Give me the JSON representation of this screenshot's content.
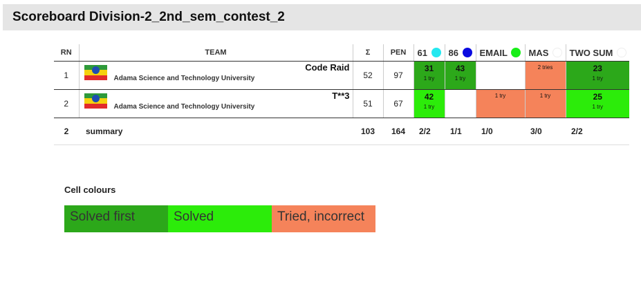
{
  "title": "Scoreboard Division-2_2nd_sem_contest_2",
  "columns": {
    "rn": "RN",
    "team": "TEAM",
    "sum": "Σ",
    "pen": "PEN"
  },
  "problems": [
    {
      "label": "61",
      "balloon": "#24e8f0"
    },
    {
      "label": "86",
      "balloon": "#0a0ae0"
    },
    {
      "label": "EMAIL",
      "balloon": "#18ee18"
    },
    {
      "label": "MAS",
      "balloon": "#ffffff"
    },
    {
      "label": "TWO SUM",
      "balloon": "#ffffff"
    }
  ],
  "teams": [
    {
      "rank": "1",
      "name": "Code Raid",
      "affiliation": "Adama Science and Technology University",
      "solved": "52",
      "penalty": "97",
      "cells": [
        {
          "status": "first",
          "points": "31",
          "tries": "1 try"
        },
        {
          "status": "first",
          "points": "43",
          "tries": "1 try"
        },
        {
          "status": "none",
          "points": "",
          "tries": ""
        },
        {
          "status": "wrong",
          "points": "",
          "tries": "2 tries"
        },
        {
          "status": "first",
          "points": "23",
          "tries": "1 try"
        }
      ]
    },
    {
      "rank": "2",
      "name": "T**3",
      "affiliation": "Adama Science and Technology University",
      "solved": "51",
      "penalty": "67",
      "cells": [
        {
          "status": "solved",
          "points": "42",
          "tries": "1 try"
        },
        {
          "status": "none",
          "points": "",
          "tries": ""
        },
        {
          "status": "wrong",
          "points": "",
          "tries": "1 try"
        },
        {
          "status": "wrong",
          "points": "",
          "tries": "1 try"
        },
        {
          "status": "solved",
          "points": "25",
          "tries": "1 try"
        }
      ]
    }
  ],
  "summary": {
    "count": "2",
    "label": "summary",
    "solved": "103",
    "penalty": "164",
    "problems": [
      "2/2",
      "1/1",
      "1/0",
      "3/0",
      "2/2"
    ]
  },
  "legend": {
    "title": "Cell colours",
    "items": [
      {
        "label": "Solved first",
        "color": "#2ca81a"
      },
      {
        "label": "Solved",
        "color": "#2cec0a"
      },
      {
        "label": "Tried, incorrect",
        "color": "#f5835a"
      }
    ]
  }
}
